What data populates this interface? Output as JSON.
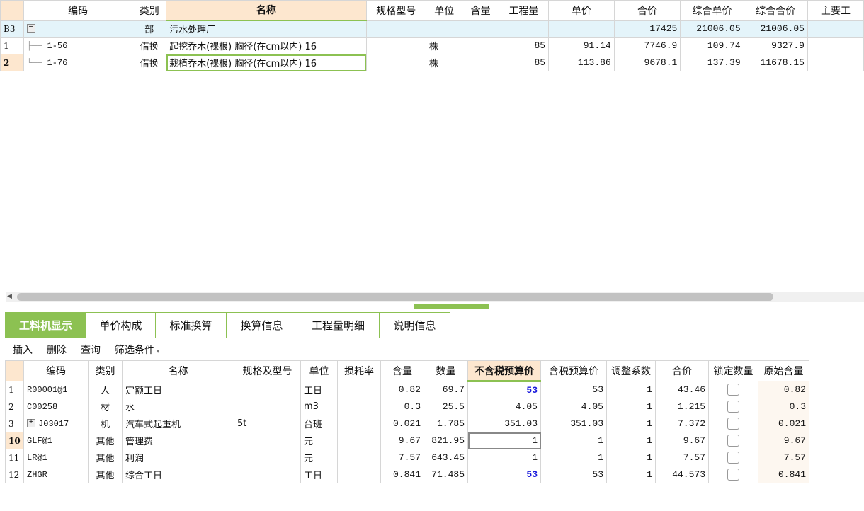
{
  "top_table": {
    "columns": [
      "",
      "编码",
      "类别",
      "名称",
      "规格型号",
      "单位",
      "含量",
      "工程量",
      "单价",
      "合价",
      "综合单价",
      "综合合价",
      "主要工"
    ],
    "selected_column": 3,
    "rows": [
      {
        "rn": "B3",
        "code": "",
        "type": "部",
        "name": "污水处理厂",
        "spec": "",
        "unit": "",
        "content": "",
        "qty": "",
        "price": "",
        "total": "17425",
        "cprice": "21006.05",
        "ctotal": "21006.05",
        "group": true,
        "tree": "minus"
      },
      {
        "rn": "1",
        "code": "1-56",
        "type": "借换",
        "name": "起挖乔木(裸根) 胸径(在cm以内) 16",
        "spec": "",
        "unit": "株",
        "content": "",
        "qty": "85",
        "price": "91.14",
        "total": "7746.9",
        "cprice": "109.74",
        "ctotal": "9327.9"
      },
      {
        "rn": "2",
        "code": "1-76",
        "type": "借换",
        "name": "栽植乔木(裸根) 胸径(在cm以内) 16",
        "spec": "",
        "unit": "株",
        "content": "",
        "qty": "85",
        "price": "113.86",
        "total": "9678.1",
        "cprice": "137.39",
        "ctotal": "11678.15",
        "current": true
      }
    ]
  },
  "tabs": [
    {
      "label": "工料机显示",
      "active": true
    },
    {
      "label": "单价构成"
    },
    {
      "label": "标准换算"
    },
    {
      "label": "换算信息"
    },
    {
      "label": "工程量明细"
    },
    {
      "label": "说明信息"
    }
  ],
  "toolbar": {
    "insert": "插入",
    "delete": "删除",
    "query": "查询",
    "filter": "筛选条件"
  },
  "bottom_table": {
    "columns": [
      "",
      "编码",
      "类别",
      "名称",
      "规格及型号",
      "单位",
      "损耗率",
      "含量",
      "数量",
      "不含税预算价",
      "含税预算价",
      "调整系数",
      "合价",
      "锁定数量",
      "原始含量"
    ],
    "selected_column": 9,
    "rows": [
      {
        "rn": "1",
        "code": "R00001@1",
        "type": "人",
        "name": "定额工日",
        "spec": "",
        "unit": "工日",
        "loss": "",
        "content": "0.82",
        "qty": "69.7",
        "price_ex": "53",
        "price_in": "53",
        "coef": "1",
        "total": "43.46",
        "locked": false,
        "orig": "0.82",
        "price_ex_blue": true
      },
      {
        "rn": "2",
        "code": "C00258",
        "type": "材",
        "name": "水",
        "spec": "",
        "unit": "m3",
        "loss": "",
        "content": "0.3",
        "qty": "25.5",
        "price_ex": "4.05",
        "price_in": "4.05",
        "coef": "1",
        "total": "1.215",
        "locked": false,
        "orig": "0.3"
      },
      {
        "rn": "3",
        "code": "J03017",
        "type": "机",
        "name": "汽车式起重机",
        "spec": "5t",
        "unit": "台班",
        "loss": "",
        "content": "0.021",
        "qty": "1.785",
        "price_ex": "351.03",
        "price_in": "351.03",
        "coef": "1",
        "total": "7.372",
        "locked": false,
        "orig": "0.021",
        "tree": "plus"
      },
      {
        "rn": "10",
        "code": "GLF@1",
        "type": "其他",
        "name": "管理费",
        "spec": "",
        "unit": "元",
        "loss": "",
        "content": "9.67",
        "qty": "821.95",
        "price_ex": "1",
        "price_in": "1",
        "coef": "1",
        "total": "9.67",
        "locked": false,
        "orig": "9.67",
        "current": true,
        "focus": true
      },
      {
        "rn": "11",
        "code": "LR@1",
        "type": "其他",
        "name": "利润",
        "spec": "",
        "unit": "元",
        "loss": "",
        "content": "7.57",
        "qty": "643.45",
        "price_ex": "1",
        "price_in": "1",
        "coef": "1",
        "total": "7.57",
        "locked": false,
        "orig": "7.57"
      },
      {
        "rn": "12",
        "code": "ZHGR",
        "type": "其他",
        "name": "综合工日",
        "spec": "",
        "unit": "工日",
        "loss": "",
        "content": "0.841",
        "qty": "71.485",
        "price_ex": "53",
        "price_in": "53",
        "coef": "1",
        "total": "44.573",
        "locked": false,
        "orig": "0.841",
        "price_ex_blue": true
      }
    ]
  }
}
